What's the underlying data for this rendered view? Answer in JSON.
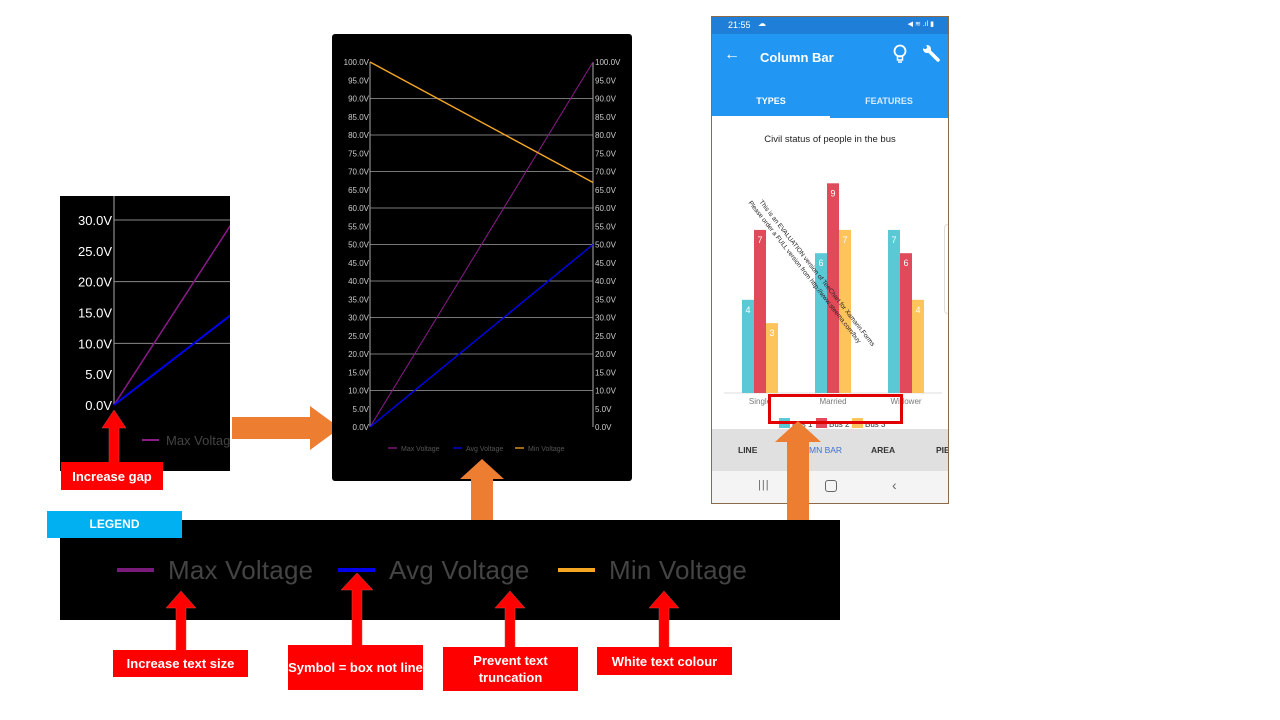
{
  "annotations": {
    "increase_gap": "Increase gap",
    "legend_badge": "LEGEND",
    "increase_text_size": "Increase text size",
    "symbol_box": "Symbol = box not line",
    "prevent_truncation": "Prevent text truncation",
    "white_text": "White text colour"
  },
  "colors": {
    "max_voltage": "#8b1a8b",
    "avg_voltage": "#0000ee",
    "min_voltage": "#f5a623",
    "annotation_red": "#ff0000",
    "arrow_orange": "#ed7d31",
    "legend_badge": "#00b0f0",
    "bus1": "#5bc8d6",
    "bus2": "#e04a5a",
    "bus3": "#fdc45c",
    "app_blue": "#2196f3"
  },
  "legend_strip": {
    "items": [
      {
        "label": "Max Voltage",
        "color": "#7a1a7a"
      },
      {
        "label": "Avg Voltage",
        "color": "#0000ee"
      },
      {
        "label": "Min Voltage",
        "color": "#f5a623"
      }
    ]
  },
  "chart_data": [
    {
      "type": "line",
      "title": "",
      "ylim": [
        0,
        30
      ],
      "y_ticks": [
        "0.0V",
        "5.0V",
        "10.0V",
        "15.0V",
        "20.0V",
        "25.0V",
        "30.0V"
      ],
      "grid": true,
      "series": [
        {
          "name": "Max Voltage",
          "x": [
            0,
            1
          ],
          "values": [
            0,
            30
          ]
        },
        {
          "name": "Avg Voltage",
          "x": [
            0,
            1
          ],
          "values": [
            0,
            15
          ]
        }
      ],
      "legend": [
        "Max Voltage"
      ],
      "legend_placement": "bottom"
    },
    {
      "type": "line",
      "title": "",
      "ylim": [
        0,
        100
      ],
      "y_ticks": [
        "0.0V",
        "5.0V",
        "10.0V",
        "15.0V",
        "20.0V",
        "25.0V",
        "30.0V",
        "35.0V",
        "40.0V",
        "45.0V",
        "50.0V",
        "55.0V",
        "60.0V",
        "65.0V",
        "70.0V",
        "75.0V",
        "80.0V",
        "85.0V",
        "90.0V",
        "95.0V",
        "100.0V"
      ],
      "grid": true,
      "series": [
        {
          "name": "Max Voltage",
          "x": [
            0,
            1
          ],
          "values": [
            0,
            100
          ]
        },
        {
          "name": "Avg Voltage",
          "x": [
            0,
            1
          ],
          "values": [
            0,
            50
          ]
        },
        {
          "name": "Min Voltage",
          "x": [
            0,
            1
          ],
          "values": [
            100,
            67
          ]
        }
      ],
      "legend": [
        "Max Voltage",
        "Avg Voltage",
        "Min Voltage"
      ],
      "legend_placement": "bottom"
    },
    {
      "type": "bar",
      "title": "Civil status of people in the bus",
      "categories": [
        "Single",
        "Married",
        "Widower"
      ],
      "series": [
        {
          "name": "Bus 1",
          "values": [
            4,
            6,
            7
          ]
        },
        {
          "name": "Bus 2",
          "values": [
            7,
            9,
            6
          ]
        },
        {
          "name": "Bus 3",
          "values": [
            3,
            7,
            4
          ]
        }
      ],
      "ylim": [
        0,
        10
      ],
      "legend_placement": "bottom",
      "watermark_line1": "This is an EVALUATION version of TeeChart for Xamarin.Forms",
      "watermark_line2": "Please order a FULL version from http://www.steema.com/buy"
    }
  ],
  "phone": {
    "time": "21:55",
    "status_icons": "◀︎ ≋ .ıl ▮",
    "title": "Column Bar",
    "tabs": [
      "TYPES",
      "FEATURES"
    ],
    "bottom_tabs": [
      "LINE",
      "MN BAR",
      "AREA",
      "PIE"
    ]
  }
}
